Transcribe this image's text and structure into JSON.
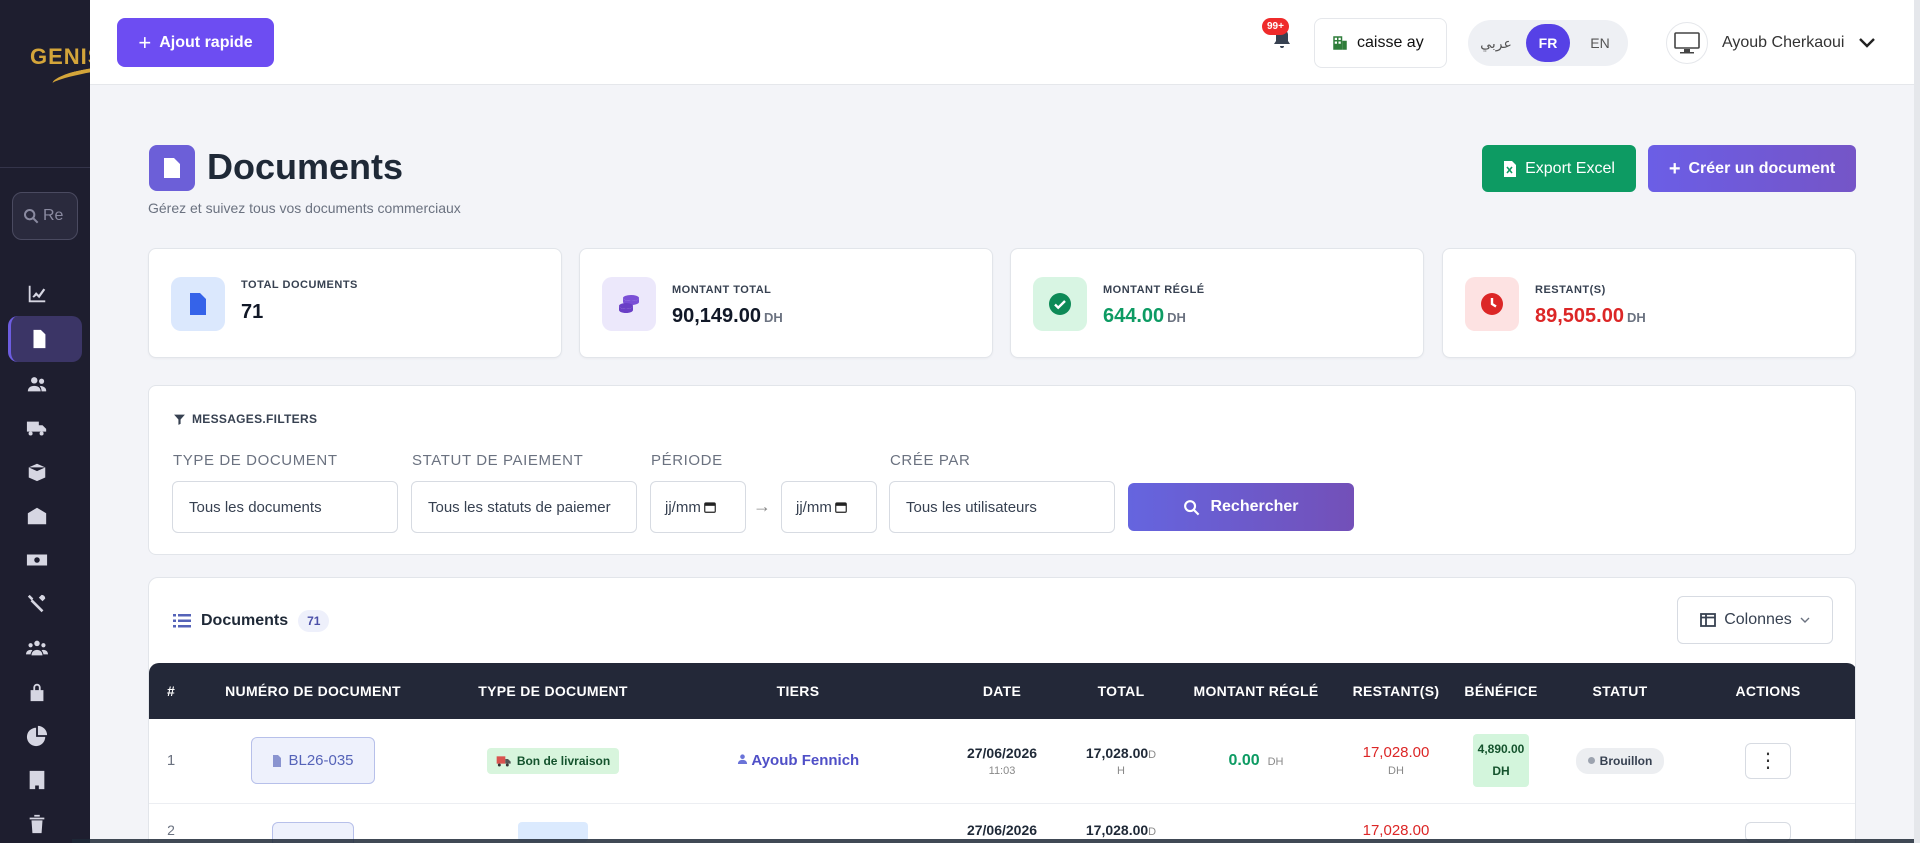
{
  "sidebar": {
    "logo_text": "GENIS",
    "search_placeholder": "Re",
    "items": [
      {
        "icon": "chart-line-icon"
      },
      {
        "icon": "file-icon",
        "active": true
      },
      {
        "icon": "users-icon"
      },
      {
        "icon": "truck-icon"
      },
      {
        "icon": "box-icon"
      },
      {
        "icon": "warehouse-icon"
      },
      {
        "icon": "money-icon"
      },
      {
        "icon": "tools-icon"
      },
      {
        "icon": "user-group-icon"
      },
      {
        "icon": "lock-icon"
      },
      {
        "icon": "pie-chart-icon"
      },
      {
        "icon": "building-icon"
      },
      {
        "icon": "trash-icon"
      }
    ]
  },
  "topbar": {
    "quick_add": "Ajout rapide",
    "notif_badge": "99+",
    "caisse": "caisse ay",
    "langs": [
      "عربي",
      "FR",
      "EN"
    ],
    "active_lang": "FR",
    "user_name": "Ayoub Cherkaoui"
  },
  "header": {
    "title": "Documents",
    "subtitle": "Gérez et suivez tous vos documents commerciaux",
    "export_label": "Export Excel",
    "create_label": "Créer un document"
  },
  "stats": [
    {
      "label": "TOTAL DOCUMENTS",
      "value": "71",
      "unit": "",
      "color": "#111827",
      "icon_bg": "#dbe8fd",
      "icon": "file-icon"
    },
    {
      "label": "MONTANT TOTAL",
      "value": "90,149.00",
      "unit": "DH",
      "color": "#111827",
      "icon_bg": "#ece8fb",
      "icon": "coins-icon"
    },
    {
      "label": "MONTANT RÉGLÉ",
      "value": "644.00",
      "unit": "DH",
      "color": "#0d9b63",
      "icon_bg": "#d8f5e3",
      "icon": "check-circle-icon"
    },
    {
      "label": "RESTANT(S)",
      "value": "89,505.00",
      "unit": "DH",
      "color": "#dc2626",
      "icon_bg": "#fde2e2",
      "icon": "clock-icon"
    }
  ],
  "filters": {
    "title": "MESSAGES.FILTERS",
    "type_label": "TYPE DE DOCUMENT",
    "type_value": "Tous les documents",
    "statut_label": "STATUT DE PAIEMENT",
    "statut_value": "Tous les statuts de paiemer",
    "periode_label": "PÉRIODE",
    "date_from": "jj/mm",
    "date_to": "jj/mm",
    "arrow": "→",
    "cree_label": "CRÉE PAR",
    "cree_value": "Tous les utilisateurs",
    "search_label": "Rechercher"
  },
  "table": {
    "title": "Documents",
    "count": "71",
    "columns_btn": "Colonnes",
    "headers": [
      "#",
      "NUMÉRO DE DOCUMENT",
      "TYPE DE DOCUMENT",
      "TIERS",
      "DATE",
      "TOTAL",
      "MONTANT RÉGLÉ",
      "RESTANT(S)",
      "BÉNÉFICE",
      "STATUT",
      "ACTIONS"
    ],
    "rows": [
      {
        "num": "1",
        "doc": "BL26-035",
        "type": "Bon de livraison",
        "tiers": "Ayoub Fennich",
        "date": "27/06/2026",
        "time": "11:03",
        "total": "17,028.00",
        "total_unit_a": "D",
        "total_unit_b": "H",
        "regle": "0.00",
        "regle_unit": "DH",
        "restant": "17,028.00",
        "restant_unit": "DH",
        "benefice": "4,890.00",
        "benefice_unit": "DH",
        "statut": "Brouillon",
        "actions": "⋮"
      },
      {
        "num": "2",
        "date": "27/06/2026",
        "total": "17,028.00",
        "total_unit_a": "D",
        "restant": "17,028.00"
      }
    ]
  }
}
